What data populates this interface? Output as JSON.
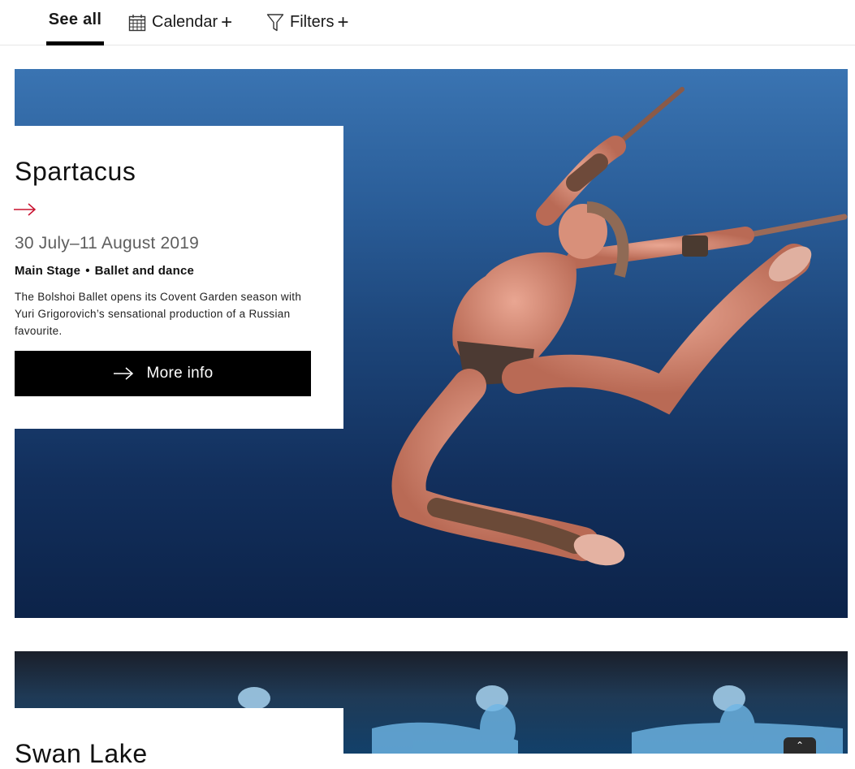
{
  "nav": {
    "see_all": "See all",
    "calendar": "Calendar",
    "filters": "Filters",
    "plus": "+"
  },
  "events": [
    {
      "title": "Spartacus",
      "date": "30 July–11 August 2019",
      "venue": "Main Stage",
      "separator": "•",
      "category": "Ballet and dance",
      "description": "The Bolshoi Ballet opens its Covent Garden season with Yuri Grigorovich’s sensational production of a Russian favourite.",
      "button": "More info"
    },
    {
      "title": "Swan Lake"
    }
  ],
  "icons": {
    "calendar": "calendar-icon",
    "filter": "filter-icon",
    "arrow": "arrow-right-icon",
    "scroll_top": "chevron-up-icon"
  },
  "colors": {
    "accent": "#c8102e",
    "button_bg": "#000000",
    "hero_blue_top": "#3a74b2",
    "hero_blue_bottom": "#0c2349"
  }
}
